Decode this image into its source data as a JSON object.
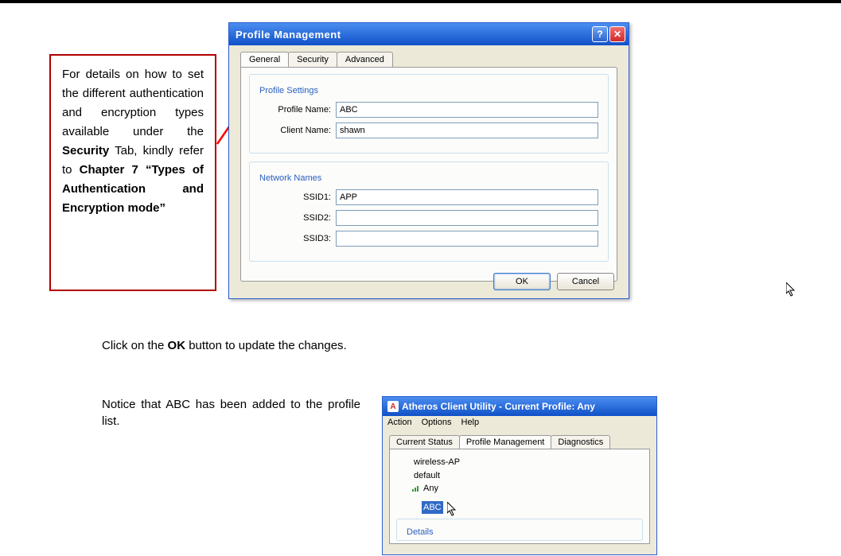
{
  "callout": {
    "pre": "For details on how to set the different authentication and encryption types available under the ",
    "bold1": "Security",
    "mid1": " Tab, kindly refer to ",
    "bold2": "Chapter 7 “Types of Authentication and Encryption mode”"
  },
  "dialog1": {
    "title": "Profile Management",
    "tabs": {
      "general": "General",
      "security": "Security",
      "advanced": "Advanced"
    },
    "profile_settings": {
      "legend": "Profile Settings",
      "profile_name_label": "Profile Name:",
      "profile_name_value": "ABC",
      "client_name_label": "Client Name:",
      "client_name_value": "shawn"
    },
    "network_names": {
      "legend": "Network Names",
      "ssid1_label": "SSID1:",
      "ssid1_value": "APP",
      "ssid2_label": "SSID2:",
      "ssid2_value": "",
      "ssid3_label": "SSID3:",
      "ssid3_value": ""
    },
    "buttons": {
      "ok": "OK",
      "cancel": "Cancel"
    }
  },
  "body": {
    "line1_pre": "Click on the ",
    "line1_bold": "OK",
    "line1_post": " button to update the changes.",
    "line2": "Notice that ABC has been added to the profile list."
  },
  "dialog2": {
    "title": "Atheros Client Utility - Current Profile: Any",
    "menu": {
      "action": "Action",
      "options": "Options",
      "help": "Help"
    },
    "tabs": {
      "current": "Current Status",
      "profile": "Profile Management",
      "diag": "Diagnostics"
    },
    "profiles": {
      "p0": "wireless-AP",
      "p1": "default",
      "p2": "Any",
      "p3": "ABC"
    },
    "details_legend": "Details"
  }
}
